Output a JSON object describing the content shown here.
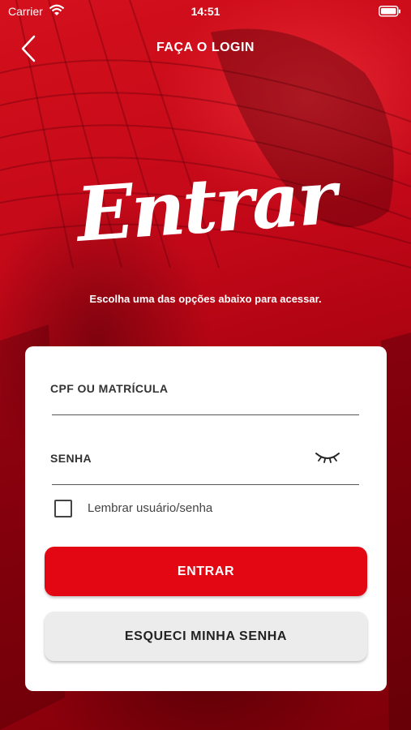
{
  "status_bar": {
    "carrier": "Carrier",
    "time": "14:51",
    "wifi_icon": "wifi-icon",
    "battery_icon": "battery-icon"
  },
  "nav": {
    "title": "FAÇA O LOGIN",
    "back_icon": "chevron-left-icon"
  },
  "hero": {
    "title": "Entrar",
    "subtitle": "Escolha uma das opções abaixo para acessar."
  },
  "form": {
    "cpf_label": "CPF OU MATRÍCULA",
    "cpf_value": "",
    "password_label": "SENHA",
    "password_value": "",
    "password_toggle_icon": "eye-closed-icon",
    "remember_label": "Lembrar usuário/senha",
    "remember_checked": false,
    "submit_label": "ENTRAR",
    "forgot_label": "ESQUECI MINHA SENHA"
  },
  "colors": {
    "brand_red": "#e30613",
    "background": "#b4000f",
    "card": "#ffffff",
    "secondary_button": "#ececec"
  }
}
